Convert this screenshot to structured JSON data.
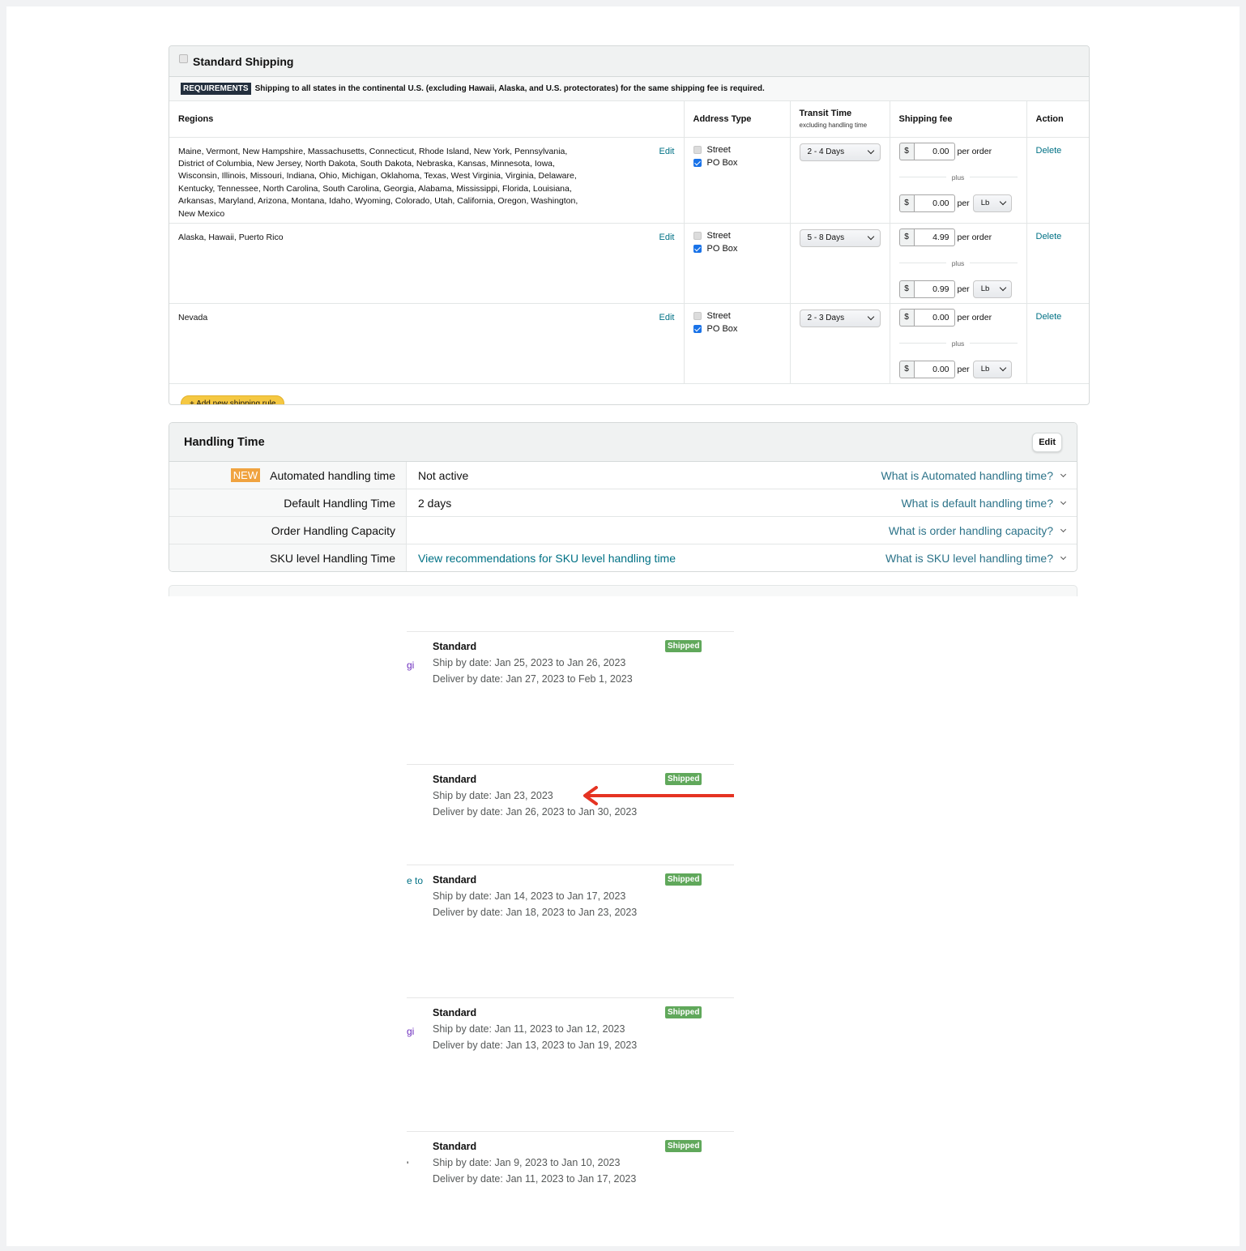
{
  "standard_shipping": {
    "title": "Standard Shipping",
    "requirements_badge": "REQUIREMENTS",
    "requirements_text": "Shipping to all states in the continental U.S. (excluding Hawaii, Alaska, and U.S. protectorates) for the same shipping fee is required.",
    "columns": {
      "regions": "Regions",
      "address_type": "Address Type",
      "transit_time": "Transit Time",
      "transit_sub": "excluding handling time",
      "shipping_fee": "Shipping fee",
      "action": "Action"
    },
    "rows": [
      {
        "regions": "Maine, Vermont, New Hampshire, Massachusetts, Connecticut, Rhode Island, New York, Pennsylvania, District of Columbia, New Jersey, North Dakota, South Dakota, Nebraska, Kansas, Minnesota, Iowa, Wisconsin, Illinois, Missouri, Indiana, Ohio, Michigan, Oklahoma, Texas, West Virginia, Virginia, Delaware, Kentucky, Tennessee, North Carolina, South Carolina, Georgia, Alabama, Mississippi, Florida, Louisiana, Arkansas, Maryland, Arizona, Montana, Idaho, Wyoming, Colorado, Utah, California, Oregon, Washington, New Mexico",
        "edit": "Edit",
        "street": "Street",
        "po_box": "PO Box",
        "transit": "2 - 4 Days",
        "currency": "$",
        "per_order_fee": "0.00",
        "per_order_label": "per order",
        "plus": "plus",
        "per_unit_fee": "0.00",
        "per_label": "per",
        "unit": "Lb",
        "action": "Delete"
      },
      {
        "regions": "Alaska, Hawaii, Puerto Rico",
        "edit": "Edit",
        "street": "Street",
        "po_box": "PO Box",
        "transit": "5 - 8 Days",
        "currency": "$",
        "per_order_fee": "4.99",
        "per_order_label": "per order",
        "plus": "plus",
        "per_unit_fee": "0.99",
        "per_label": "per",
        "unit": "Lb",
        "action": "Delete"
      },
      {
        "regions": "Nevada",
        "edit": "Edit",
        "street": "Street",
        "po_box": "PO Box",
        "transit": "2 - 3 Days",
        "currency": "$",
        "per_order_fee": "0.00",
        "per_order_label": "per order",
        "plus": "plus",
        "per_unit_fee": "0.00",
        "per_label": "per",
        "unit": "Lb",
        "action": "Delete"
      }
    ],
    "add_rule": "+ Add new shipping rule"
  },
  "handling_time": {
    "title": "Handling Time",
    "edit": "Edit",
    "new_badge": "NEW",
    "rows": [
      {
        "label": "Automated handling time",
        "value": "Not active",
        "help": "What is Automated handling time?"
      },
      {
        "label": "Default Handling Time",
        "value": "2 days",
        "help": "What is default handling time?"
      },
      {
        "label": "Order Handling Capacity",
        "value": "",
        "help": "What is order handling capacity?"
      },
      {
        "label": "SKU level Handling Time",
        "value": "View recommendations for SKU level handling time",
        "help": "What is SKU level handling time?"
      }
    ]
  },
  "orders": [
    {
      "prefix": "gi",
      "service": "Standard",
      "status": "Shipped",
      "ship_by": "Ship by date: Jan 25, 2023 to Jan 26, 2023",
      "deliver_by": "Deliver by date: Jan 27, 2023 to Feb 1, 2023"
    },
    {
      "prefix": "",
      "service": "Standard",
      "status": "Shipped",
      "ship_by": "Ship by date: Jan 23, 2023",
      "deliver_by": "Deliver by date: Jan 26, 2023 to Jan 30, 2023"
    },
    {
      "prefix": "e to",
      "service": "Standard",
      "status": "Shipped",
      "ship_by": "Ship by date: Jan 14, 2023 to Jan 17, 2023",
      "deliver_by": "Deliver by date: Jan 18, 2023 to Jan 23, 2023"
    },
    {
      "prefix": "gi",
      "service": "Standard",
      "status": "Shipped",
      "ship_by": "Ship by date: Jan 11, 2023 to Jan 12, 2023",
      "deliver_by": "Deliver by date: Jan 13, 2023 to Jan 19, 2023"
    },
    {
      "prefix": "'",
      "service": "Standard",
      "status": "Shipped",
      "ship_by": "Ship by date: Jan 9, 2023 to Jan 10, 2023",
      "deliver_by": "Deliver by date: Jan 11, 2023 to Jan 17, 2023"
    }
  ],
  "annotation": {
    "icon": "red-arrow-left",
    "color": "#e53322"
  }
}
